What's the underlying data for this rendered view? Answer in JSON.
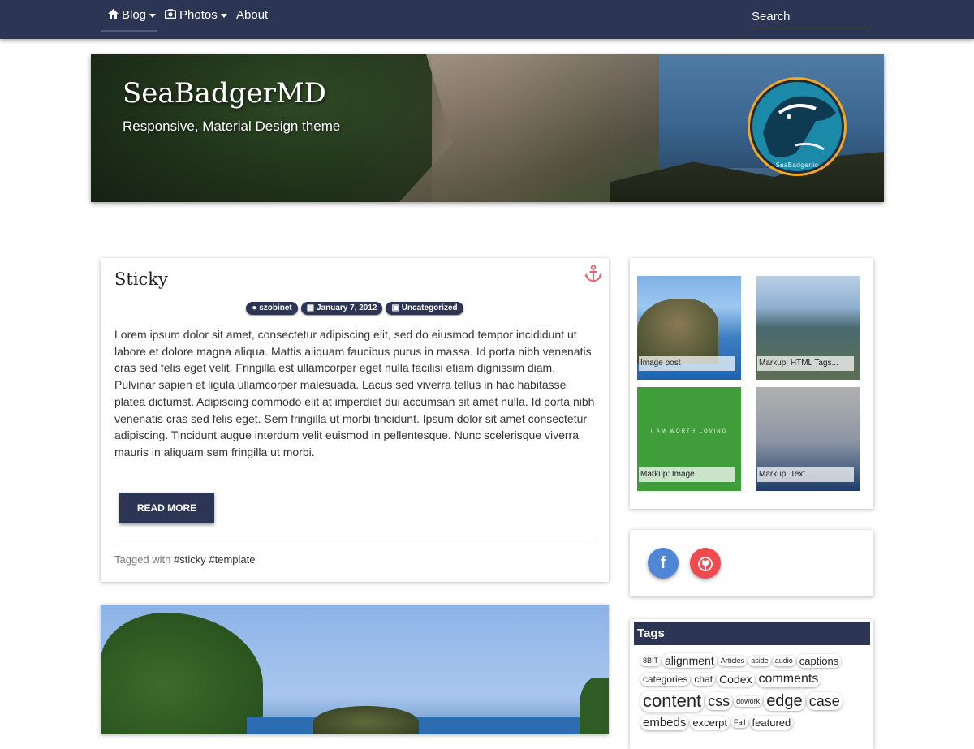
{
  "nav": {
    "blog_label": "Blog",
    "photos_label": "Photos",
    "about_label": "About",
    "search_placeholder": "Search"
  },
  "header": {
    "title": "SeaBadgerMD",
    "tagline": "Responsive, Material Design theme",
    "logo_text": "SeaBadger.io"
  },
  "post": {
    "title": "Sticky",
    "author": "szobinet",
    "date": "January 7, 2012",
    "category": "Uncategorized",
    "excerpt": "Lorem ipsum dolor sit amet, consectetur adipiscing elit, sed do eiusmod tempor incididunt ut labore et dolore magna aliqua. Mattis aliquam faucibus purus in massa. Id porta nibh venenatis cras sed felis eget velit. Fringilla est ullamcorper eget nulla facilisi etiam dignissim diam. Pulvinar sapien et ligula ullamcorper malesuada. Lacus sed viverra tellus in hac habitasse platea dictumst. Adipiscing commodo elit at imperdiet dui accumsan sit amet nulla. Id porta nibh venenatis cras sed felis eget. Sem fringilla ut morbi tincidunt. Ipsum dolor sit amet consectetur adipiscing. Tincidunt augue interdum velit euismod in pellentesque. Nunc scelerisque viverra mauris in aliquam sem fringilla ut morbi.",
    "read_more_label": "READ MORE",
    "tags_prefix": "Tagged with",
    "tags": [
      "#sticky",
      "#template"
    ]
  },
  "sidebar": {
    "gallery": [
      {
        "caption": "Image post"
      },
      {
        "caption": "Markup: HTML Tags..."
      },
      {
        "caption": "Markup: Image...",
        "overlay_text": "I AM WORTH LOVING"
      },
      {
        "caption": "Markup: Text..."
      }
    ],
    "social": [
      {
        "name": "facebook",
        "glyph": "f"
      },
      {
        "name": "github",
        "glyph": "◉"
      }
    ],
    "tags_title": "Tags",
    "tag_cloud": [
      {
        "label": "8BIT",
        "size": 9
      },
      {
        "label": "alignment",
        "size": 14
      },
      {
        "label": "Articles",
        "size": 9
      },
      {
        "label": "aside",
        "size": 9
      },
      {
        "label": "audio",
        "size": 9
      },
      {
        "label": "captions",
        "size": 13
      },
      {
        "label": "categories",
        "size": 12
      },
      {
        "label": "chat",
        "size": 12
      },
      {
        "label": "Codex",
        "size": 14
      },
      {
        "label": "comments",
        "size": 16
      },
      {
        "label": "content",
        "size": 22
      },
      {
        "label": "css",
        "size": 18
      },
      {
        "label": "dowork",
        "size": 9
      },
      {
        "label": "edge",
        "size": 20
      },
      {
        "label": "case",
        "size": 18
      },
      {
        "label": "embeds",
        "size": 15
      },
      {
        "label": "excerpt",
        "size": 13
      },
      {
        "label": "Fail",
        "size": 9
      },
      {
        "label": "featured",
        "size": 13
      }
    ]
  },
  "colors": {
    "primary": "#2c3554",
    "accent": "#f06374",
    "facebook": "#4f86d6",
    "github": "#ef4a4e"
  }
}
